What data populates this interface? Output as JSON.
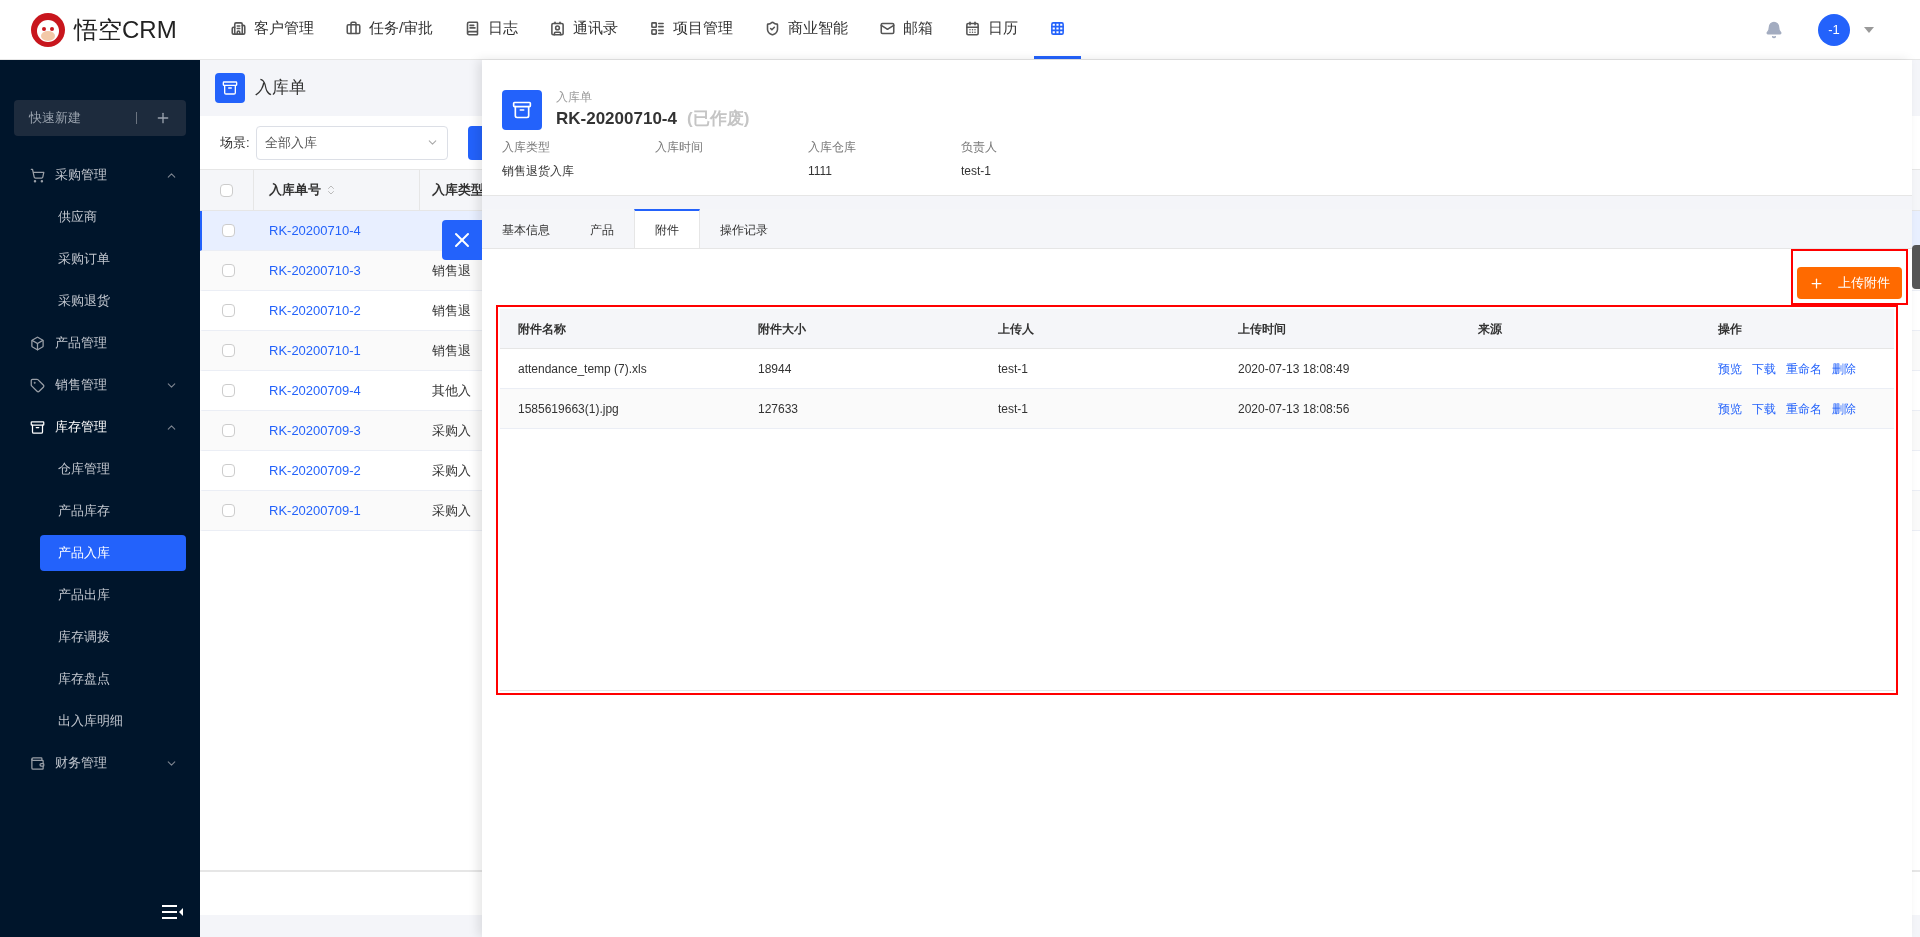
{
  "app": {
    "logo_text": "悟空CRM"
  },
  "nav": [
    {
      "label": "客户管理",
      "selected": false
    },
    {
      "label": "任务/审批",
      "selected": false
    },
    {
      "label": "日志",
      "selected": false
    },
    {
      "label": "通讯录",
      "selected": false
    },
    {
      "label": "项目管理",
      "selected": false
    },
    {
      "label": "商业智能",
      "selected": false
    },
    {
      "label": "邮箱",
      "selected": false
    },
    {
      "label": "日历",
      "selected": false
    }
  ],
  "apps_menu": {
    "selected": true
  },
  "user": {
    "avatar_text": "-1"
  },
  "sidebar": {
    "quick_create": "快速新建",
    "items": [
      {
        "label": "采购管理",
        "expanded": true,
        "children": [
          {
            "label": "供应商",
            "selected": false
          },
          {
            "label": "采购订单",
            "selected": false
          },
          {
            "label": "采购退货",
            "selected": false
          }
        ]
      },
      {
        "label": "产品管理"
      },
      {
        "label": "销售管理",
        "expanded": false
      },
      {
        "label": "库存管理",
        "expanded": true,
        "children": [
          {
            "label": "仓库管理",
            "selected": false
          },
          {
            "label": "产品库存",
            "selected": false
          },
          {
            "label": "产品入库",
            "selected": true
          },
          {
            "label": "产品出库",
            "selected": false
          },
          {
            "label": "库存调拨",
            "selected": false
          },
          {
            "label": "库存盘点",
            "selected": false
          },
          {
            "label": "出入库明细",
            "selected": false
          }
        ]
      },
      {
        "label": "财务管理",
        "expanded": false
      }
    ]
  },
  "list": {
    "title": "入库单",
    "scene_label": "场景:",
    "scene_value": "全部入库",
    "columns": [
      "入库单号",
      "入库类型"
    ],
    "all_checked": false,
    "rows": [
      {
        "number": "RK-20200710-4",
        "selected": true,
        "checked": false
      },
      {
        "number": "RK-20200710-3",
        "type": "销售退",
        "selected": false,
        "checked": false
      },
      {
        "number": "RK-20200710-2",
        "type": "销售退",
        "selected": false,
        "checked": false
      },
      {
        "number": "RK-20200710-1",
        "type": "销售退",
        "selected": false,
        "checked": false
      },
      {
        "number": "RK-20200709-4",
        "type": "其他入",
        "selected": false,
        "checked": false
      },
      {
        "number": "RK-20200709-3",
        "type": "采购入",
        "selected": false,
        "checked": false
      },
      {
        "number": "RK-20200709-2",
        "type": "采购入",
        "selected": false,
        "checked": false
      },
      {
        "number": "RK-20200709-1",
        "type": "采购入",
        "selected": false,
        "checked": false
      }
    ]
  },
  "detail": {
    "kind_label": "入库单",
    "title": "RK-20200710-4",
    "status": "(已作废)",
    "fields": [
      {
        "label": "入库类型",
        "value": "销售退货入库"
      },
      {
        "label": "入库时间"
      },
      {
        "label": "入库仓库",
        "value": "1111"
      },
      {
        "label": "负责人",
        "value": "test-1"
      }
    ],
    "tabs": [
      {
        "label": "基本信息",
        "selected": false
      },
      {
        "label": "产品",
        "selected": false
      },
      {
        "label": "附件",
        "selected": true
      },
      {
        "label": "操作记录",
        "selected": false
      }
    ],
    "upload_button": "上传附件",
    "table": {
      "columns": [
        "附件名称",
        "附件大小",
        "上传人",
        "上传时间",
        "来源",
        "操作"
      ],
      "rows": [
        {
          "name": "attendance_temp (7).xls",
          "size": "18944",
          "uploader": "test-1",
          "time": "2020-07-13 18:08:49",
          "actions": [
            "预览",
            "下载",
            "重命名",
            "删除"
          ]
        },
        {
          "name": "1585619663(1).jpg",
          "size": "127633",
          "uploader": "test-1",
          "time": "2020-07-13 18:08:56",
          "actions": [
            "预览",
            "下载",
            "重命名",
            "删除"
          ]
        }
      ]
    }
  }
}
